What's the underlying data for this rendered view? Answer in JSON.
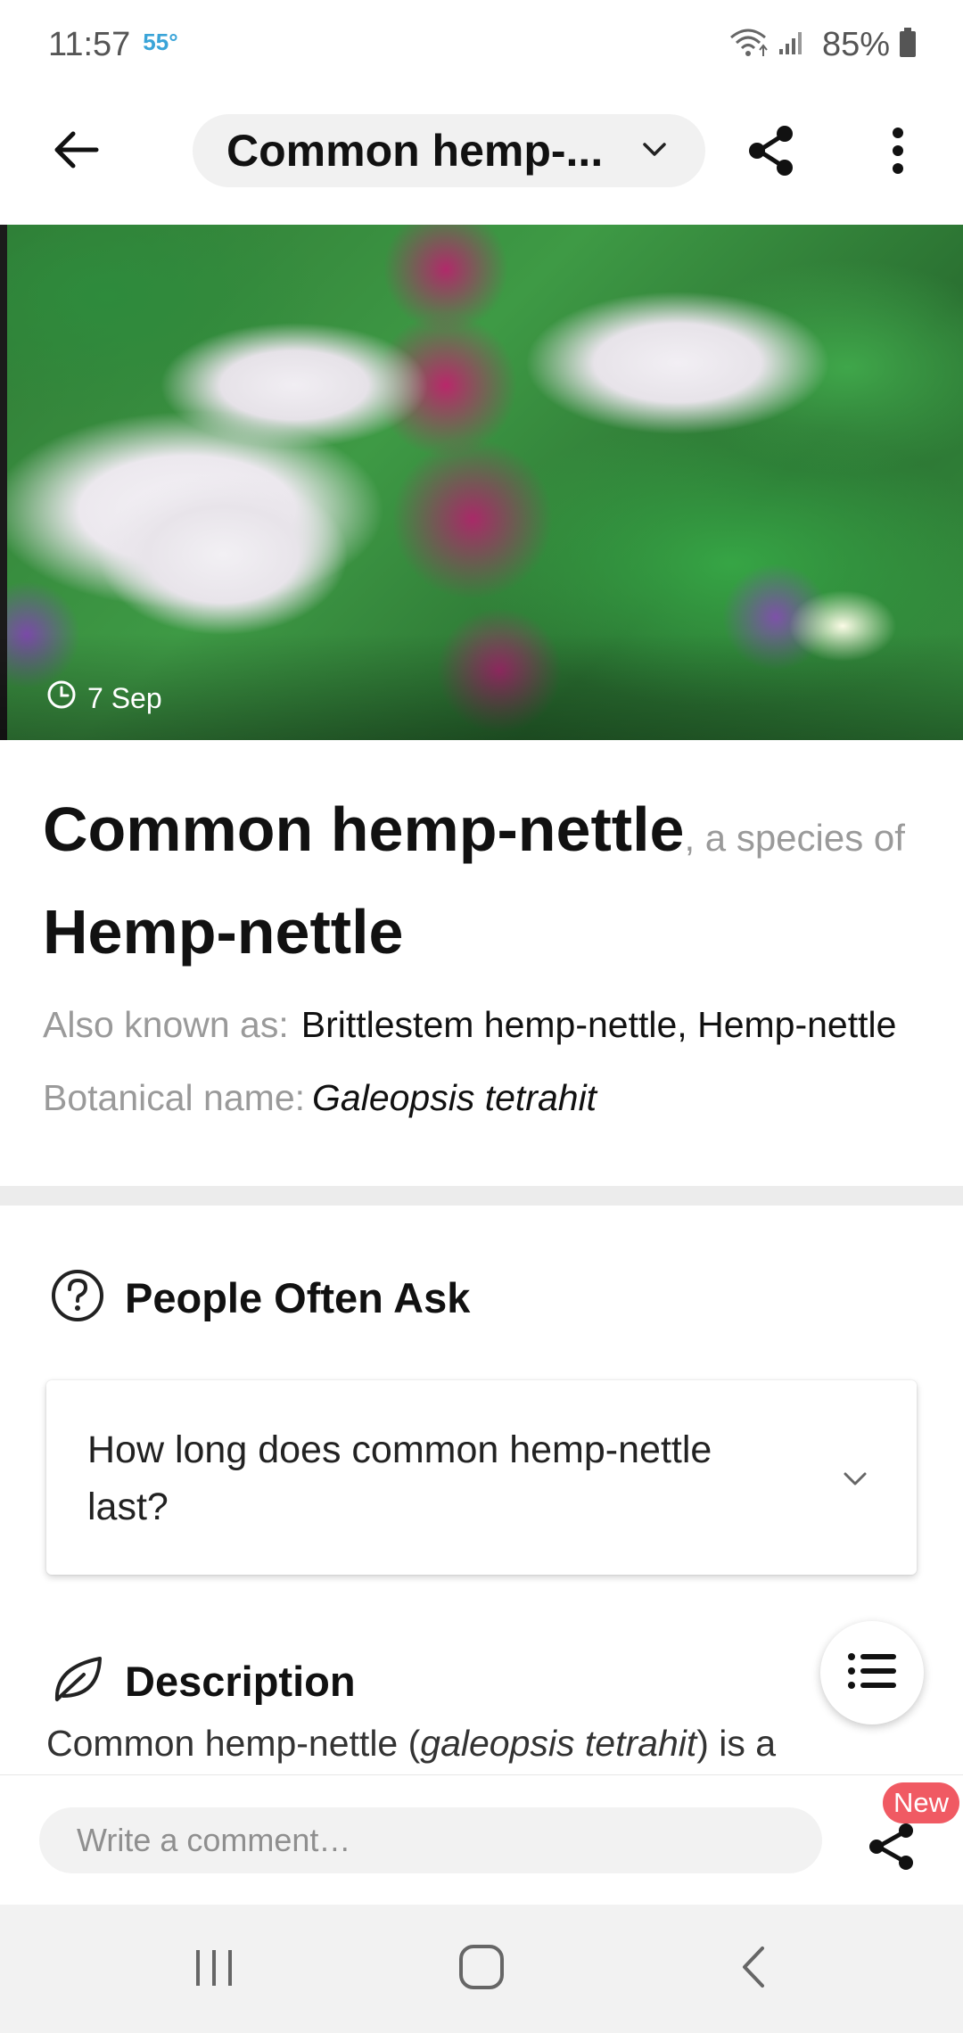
{
  "status_bar": {
    "time": "11:57",
    "temperature": "55°",
    "battery": "85%"
  },
  "app_bar": {
    "title": "Common hemp-...",
    "icons": [
      "back-arrow-icon",
      "chevron-down-icon",
      "share-icon",
      "more-vert-icon"
    ]
  },
  "hero": {
    "date": "7 Sep",
    "date_icon": "clock-icon"
  },
  "plant": {
    "common_name": "Common hemp-nettle",
    "species_connector": ", a species of",
    "genus": "Hemp-nettle",
    "aka_label": "Also known as:",
    "aka_value": "Brittlestem hemp-nettle, Hemp-nettle",
    "botanical_label": "Botanical name:",
    "botanical_value": "Galeopsis tetrahit"
  },
  "people_often_ask": {
    "title": "People Often Ask",
    "icon": "question-circle-icon",
    "questions": [
      {
        "text": "How long does common hemp-nettle last?"
      }
    ]
  },
  "description": {
    "title": "Description",
    "icon": "leaf-icon",
    "text_prefix": "Common hemp-nettle (",
    "text_italic": "galeopsis tetrahit",
    "text_suffix": ") is a"
  },
  "comment_bar": {
    "placeholder": "Write a comment…",
    "badge": "New"
  },
  "nav_bar": {
    "buttons": [
      "recents-icon",
      "home-icon",
      "back-icon"
    ]
  },
  "colors": {
    "accent_temp": "#3aa4d8",
    "badge": "#f05a63",
    "muted_text": "#9a9a9a"
  }
}
